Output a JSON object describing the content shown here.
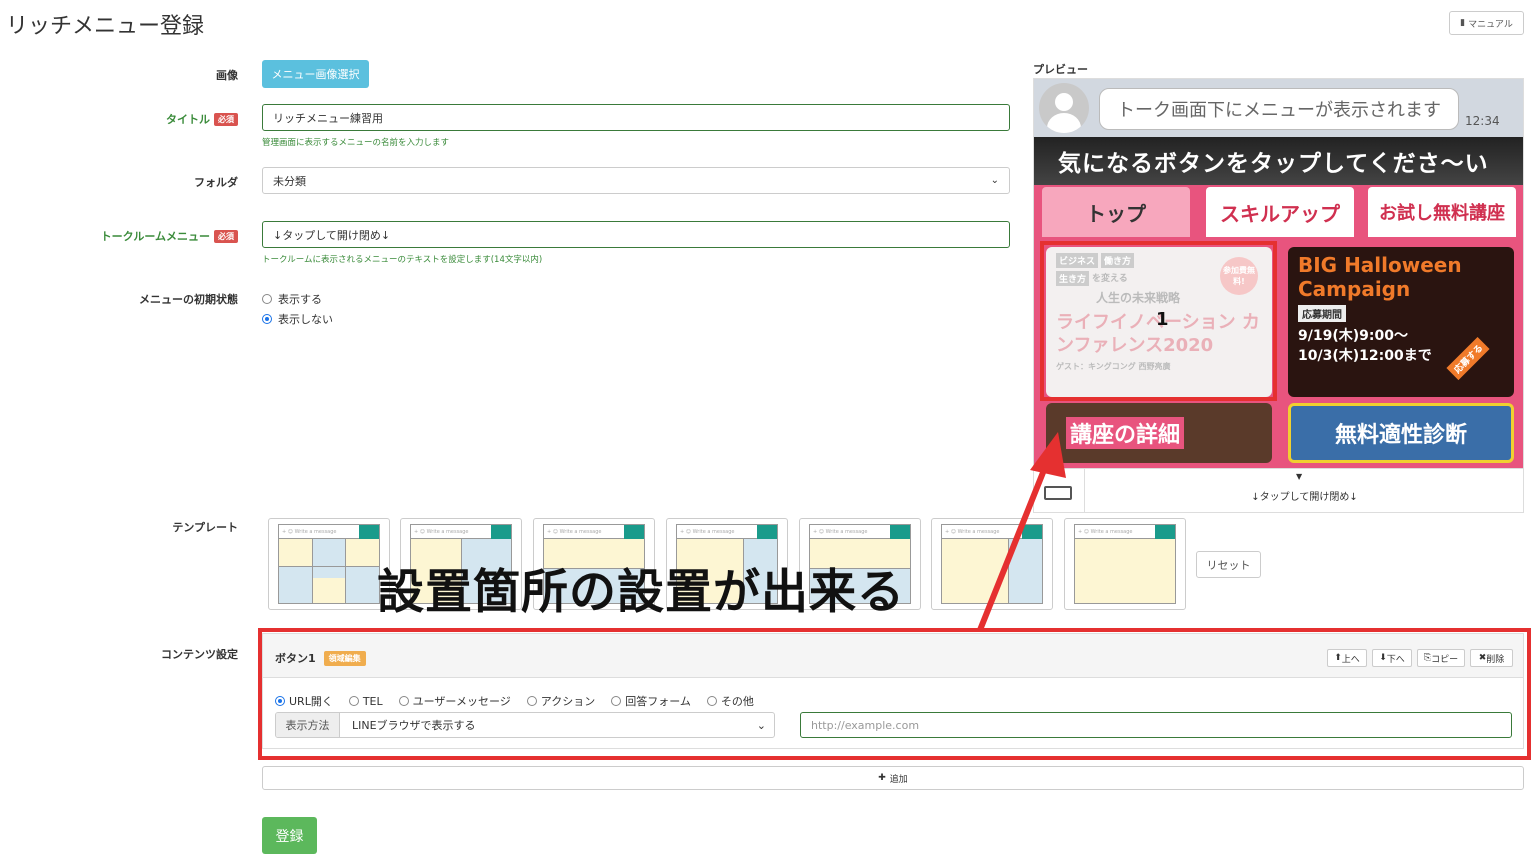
{
  "page": {
    "title": "リッチメニュー登録",
    "manual_label": "マニュアル"
  },
  "form": {
    "image_label": "画像",
    "image_button": "メニュー画像選択",
    "title_label": "タイトル",
    "required_badge": "必須",
    "title_value": "リッチメニュー練習用",
    "title_help": "管理画面に表示するメニューの名前を入力します",
    "folder_label": "フォルダ",
    "folder_value": "未分類",
    "talkroom_label": "トークルームメニュー",
    "talkroom_value": "↓タップして開け閉め↓",
    "talkroom_help": "トークルームに表示されるメニューのテキストを設定します(14文字以内)",
    "initial_label": "メニューの初期状態",
    "initial_options": [
      "表示する",
      "表示しない"
    ],
    "initial_selected": "表示しない"
  },
  "preview": {
    "label": "プレビュー",
    "bubble_text": "トーク画面下にメニューが表示されます",
    "time": "12:34",
    "banner": "気になるボタンをタップしてくださ〜い",
    "tabs": [
      "トップ",
      "スキルアップ",
      "お試し無料講座"
    ],
    "tiles": {
      "t1_tags": [
        "ビジネス",
        "働き方",
        "生き方",
        "を変える"
      ],
      "t1_sub": "人生の未来戦略",
      "t1_badge": "参加費無料!",
      "t1_title": "ライフイノベーション カンファレンス2020",
      "t1_guest": "ゲスト：キングコング 西野亮廣",
      "t1_number": "1",
      "t2_title": "BIG Halloween Campaign",
      "t2_period_label": "応募期間",
      "t2_from": "9/19(木)9:00〜",
      "t2_to": "10/3(木)12:00まで",
      "t2_badge": "応募する",
      "t3_title": "講座の詳細",
      "t4_title": "無料適性診断"
    },
    "footer_text": "↓タップして開け閉め↓"
  },
  "templates": {
    "label": "テンプレート",
    "bar_text": "+ ☺ Write a message",
    "reset": "リセット"
  },
  "overlay_text": "設置箇所の設置が出来る",
  "content": {
    "label": "コンテンツ設定",
    "button_title": "ボタン1",
    "edit_area": "領域編集",
    "actions": [
      "上へ",
      "下へ",
      "コピー",
      "削除"
    ],
    "types": [
      "URL開く",
      "TEL",
      "ユーザーメッセージ",
      "アクション",
      "回答フォーム",
      "その他"
    ],
    "type_selected": "URL開く",
    "method_label": "表示方法",
    "method_value": "LINEブラウザで表示する",
    "url_placeholder": "http://example.com",
    "add_label": "追加"
  },
  "submit_label": "登録",
  "colors": {
    "accent_red": "#e53030",
    "green": "#5cb85c",
    "blue": "#5bc0de",
    "orange": "#f0ad4e",
    "pink": "#e8547e"
  }
}
